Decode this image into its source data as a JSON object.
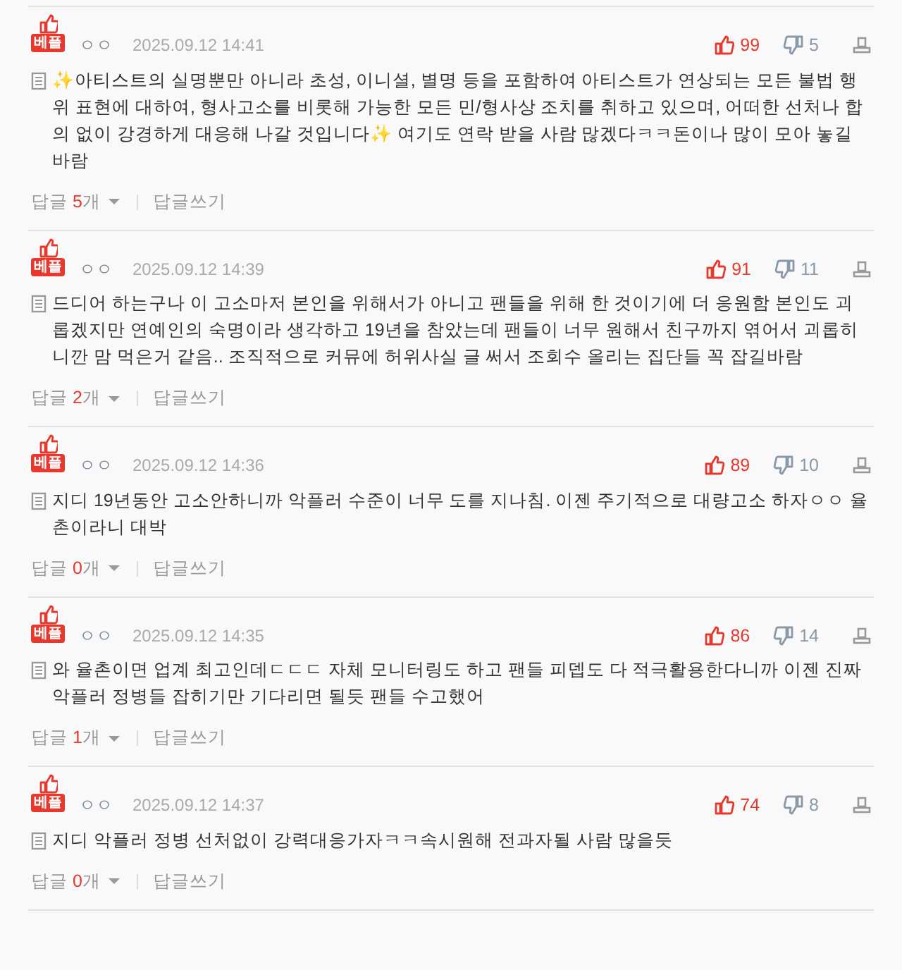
{
  "comments": [
    {
      "badge": "베플",
      "author": "ㅇㅇ",
      "date": "2025.09.12 14:41",
      "likes": "99",
      "dislikes": "5",
      "text": "✨아티스트의 실명뿐만 아니라 초성, 이니셜, 별명 등을 포함하여 아티스트가 연상되는 모든 불법 행위 표현에 대하여, 형사고소를 비롯해 가능한 모든 민/형사상 조치를 취하고 있으며, 어떠한 선처나 합의 없이 강경하게 대응해 나갈 것입니다✨ 여기도 연락 받을 사람 많겠다ㅋㅋ돈이나 많이 모아 놓길 바람",
      "reply_label": "답글",
      "reply_count": "5",
      "reply_unit": "개",
      "write_reply": "답글쓰기"
    },
    {
      "badge": "베플",
      "author": "ㅇㅇ",
      "date": "2025.09.12 14:39",
      "likes": "91",
      "dislikes": "11",
      "text": "드디어 하는구나 이 고소마저 본인을 위해서가 아니고 팬들을 위해 한 것이기에 더 응원함 본인도 괴롭겠지만 연예인의 숙명이라 생각하고 19년을 참았는데 팬들이 너무 원해서 친구까지 엮어서 괴롭히니깐 맘 먹은거 같음.. 조직적으로 커뮤에 허위사실 글 써서 조회수 올리는 집단들 꼭 잡길바람",
      "reply_label": "답글",
      "reply_count": "2",
      "reply_unit": "개",
      "write_reply": "답글쓰기"
    },
    {
      "badge": "베플",
      "author": "ㅇㅇ",
      "date": "2025.09.12 14:36",
      "likes": "89",
      "dislikes": "10",
      "text": "지디 19년동안 고소안하니까 악플러 수준이 너무 도를 지나침. 이젠 주기적으로 대량고소 하자ㅇㅇ 율촌이라니 대박",
      "reply_label": "답글",
      "reply_count": "0",
      "reply_unit": "개",
      "write_reply": "답글쓰기"
    },
    {
      "badge": "베플",
      "author": "ㅇㅇ",
      "date": "2025.09.12 14:35",
      "likes": "86",
      "dislikes": "14",
      "text": "와 율촌이면 업계 최고인데ㄷㄷㄷ 자체 모니터링도 하고 팬들 피뎁도 다 적극활용한다니까 이젠 진짜 악플러 정병들 잡히기만 기다리면 될듯 팬들 수고했어",
      "reply_label": "답글",
      "reply_count": "1",
      "reply_unit": "개",
      "write_reply": "답글쓰기"
    },
    {
      "badge": "베플",
      "author": "ㅇㅇ",
      "date": "2025.09.12 14:37",
      "likes": "74",
      "dislikes": "8",
      "text": "지디 악플러 정병 선처없이 강력대응가자ㅋㅋ속시원해 전과자될 사람 많을듯",
      "reply_label": "답글",
      "reply_count": "0",
      "reply_unit": "개",
      "write_reply": "답글쓰기"
    }
  ]
}
